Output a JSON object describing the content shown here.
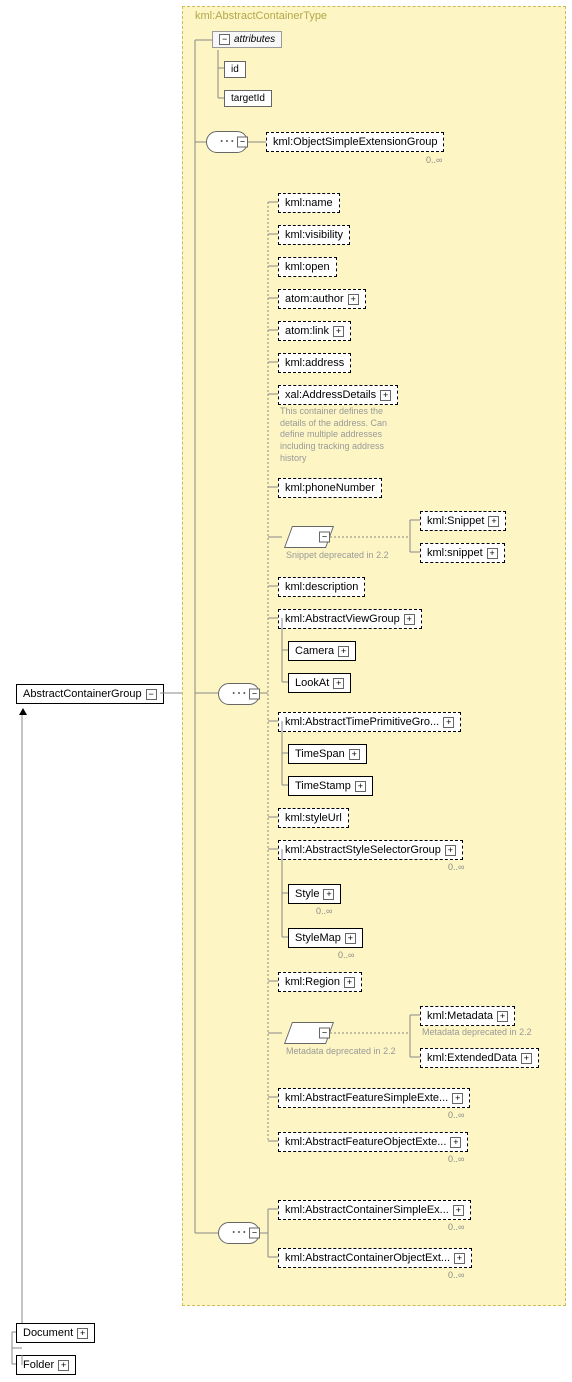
{
  "type_label": "kml:AbstractContainerType",
  "root": "AbstractContainerGroup",
  "attributes_label": "attributes",
  "attrs": [
    "id",
    "targetId"
  ],
  "obj_ext": "kml:ObjectSimpleExtensionGroup",
  "elems": {
    "name": "kml:name",
    "visibility": "kml:visibility",
    "open": "kml:open",
    "atom_author": "atom:author",
    "atom_link": "atom:link",
    "address": "kml:address",
    "xal_address": "xal:AddressDetails",
    "xal_note": "This container defines the details of the address. Can define multiple addresses including tracking address history",
    "phone": "kml:phoneNumber",
    "snippet_upper": "kml:Snippet",
    "snippet_lower": "kml:snippet",
    "snippet_note": "Snippet deprecated in 2.2",
    "description": "kml:description",
    "abstract_view": "kml:AbstractViewGroup",
    "camera": "Camera",
    "lookat": "LookAt",
    "abstract_time": "kml:AbstractTimePrimitiveGro...",
    "timespan": "TimeSpan",
    "timestamp": "TimeStamp",
    "styleurl": "kml:styleUrl",
    "abstract_style": "kml:AbstractStyleSelectorGroup",
    "style": "Style",
    "stylemap": "StyleMap",
    "region": "kml:Region",
    "metadata": "kml:Metadata",
    "metadata_note": "Metadata deprecated in 2.2",
    "extended": "kml:ExtendedData",
    "feat_simple": "kml:AbstractFeatureSimpleExte...",
    "feat_object": "kml:AbstractFeatureObjectExte...",
    "cont_simple": "kml:AbstractContainerSimpleEx...",
    "cont_object": "kml:AbstractContainerObjectExt..."
  },
  "card_inf": "0..∞",
  "subst": {
    "document": "Document",
    "folder": "Folder"
  }
}
